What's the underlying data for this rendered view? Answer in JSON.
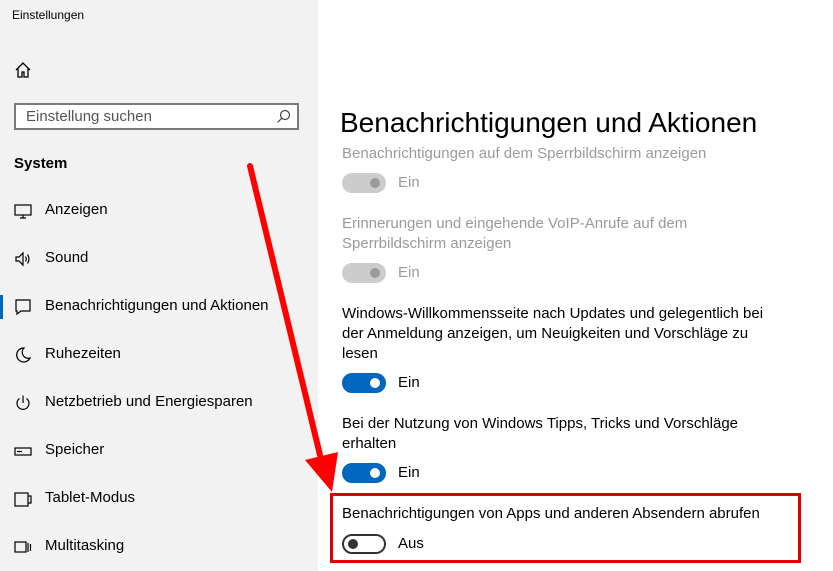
{
  "window": {
    "title": "Einstellungen"
  },
  "search": {
    "placeholder": "Einstellung suchen"
  },
  "sidebar": {
    "section": "System",
    "items": [
      {
        "label": "Anzeigen",
        "icon": "monitor-icon"
      },
      {
        "label": "Sound",
        "icon": "speaker-icon"
      },
      {
        "label": "Benachrichtigungen und Aktionen",
        "icon": "notification-icon",
        "active": true
      },
      {
        "label": "Ruhezeiten",
        "icon": "moon-icon"
      },
      {
        "label": "Netzbetrieb und Energiesparen",
        "icon": "power-icon"
      },
      {
        "label": "Speicher",
        "icon": "storage-icon"
      },
      {
        "label": "Tablet-Modus",
        "icon": "tablet-icon"
      },
      {
        "label": "Multitasking",
        "icon": "multitasking-icon"
      }
    ]
  },
  "main": {
    "title": "Benachrichtigungen und Aktionen",
    "settings": [
      {
        "text": "Benachrichtigungen auf dem Sperrbildschirm anzeigen",
        "state": "Ein",
        "disabled": true
      },
      {
        "text": "Erinnerungen und eingehende VoIP-Anrufe auf dem Sperrbildschirm anzeigen",
        "state": "Ein",
        "disabled": true
      },
      {
        "text": "Windows-Willkommensseite nach Updates und gelegentlich bei der Anmeldung anzeigen, um Neuigkeiten und Vorschläge zu lesen",
        "state": "Ein",
        "disabled": false
      },
      {
        "text": "Bei der Nutzung von Windows Tipps, Tricks und Vorschläge erhalten",
        "state": "Ein",
        "disabled": false
      },
      {
        "text": "Benachrichtigungen von Apps und anderen Absendern abrufen",
        "state": "Aus",
        "disabled": false
      }
    ]
  },
  "colors": {
    "accent": "#0067c0",
    "highlight": "#e00000",
    "sidebar_bg": "#f2f2f2",
    "disabled": "#9a9a9a"
  }
}
